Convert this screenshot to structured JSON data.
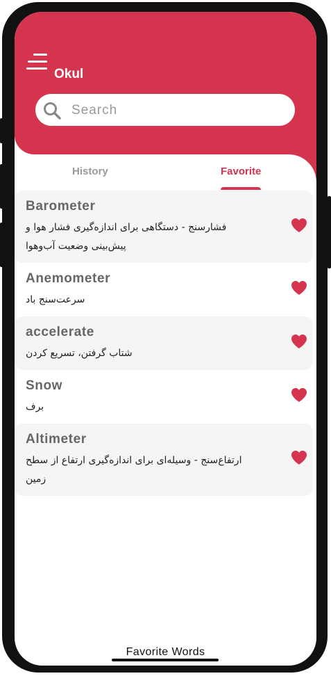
{
  "app": {
    "title": "Okul",
    "accent_color": "#d5344f"
  },
  "header": {
    "menu_icon": "hamburger-menu-icon"
  },
  "search": {
    "icon": "search-icon",
    "placeholder": "Search",
    "value": ""
  },
  "tabs": {
    "history_label": "History",
    "favorite_label": "Favorite",
    "active": "Favorite"
  },
  "favorites": [
    {
      "word": "Barometer",
      "meaning": "فشارسنج - دستگاهی برای اندازه‌گیری فشار هوا و پیش‌بینی وضعیت آب‌وهوا",
      "icon": "heart-icon"
    },
    {
      "word": "Anemometer",
      "meaning": "سرعت‌سنج باد",
      "icon": "heart-icon"
    },
    {
      "word": "accelerate",
      "meaning": "شتاب گرفتن، تسریع کردن",
      "icon": "heart-icon"
    },
    {
      "word": "Snow",
      "meaning": "برف",
      "icon": "heart-icon"
    },
    {
      "word": "Altimeter",
      "meaning": "ارتفاع‌سنج - وسیله‌ای برای اندازه‌گیری ارتفاع از سطح زمین",
      "icon": "heart-icon"
    }
  ],
  "footer": {
    "caption": "Favorite Words"
  }
}
